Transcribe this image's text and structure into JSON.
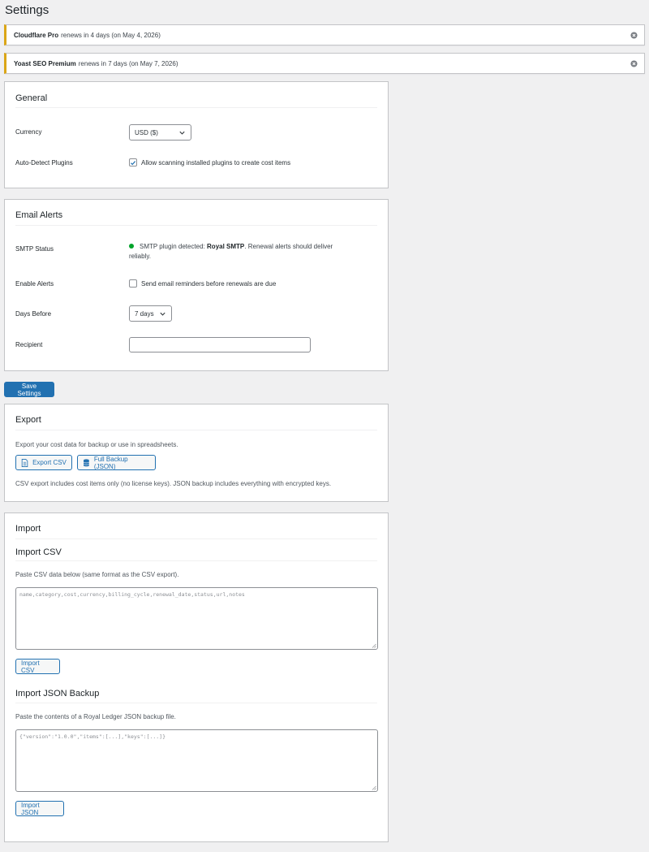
{
  "page": {
    "title": "Settings"
  },
  "notices": [
    {
      "product": "Cloudflare Pro",
      "text": "renews in 4 days (on May 4, 2026)"
    },
    {
      "product": "Yoast SEO Premium",
      "text": "renews in 7 days (on May 7, 2026)"
    }
  ],
  "general": {
    "heading": "General",
    "currency_label": "Currency",
    "currency_value": "USD ($)",
    "autodetect_label": "Auto-Detect Plugins",
    "autodetect_text": "Allow scanning installed plugins to create cost items",
    "autodetect_checked": true
  },
  "email": {
    "heading": "Email Alerts",
    "smtp_label": "SMTP Status",
    "smtp_prefix": "SMTP plugin detected:",
    "smtp_plugin": "Royal SMTP",
    "smtp_suffix": ". Renewal alerts should deliver",
    "smtp_line2": "reliably.",
    "smtp_status_color": "#00a32a",
    "enable_label": "Enable Alerts",
    "enable_text": "Send email reminders before renewals are due",
    "enable_checked": false,
    "days_label": "Days Before",
    "days_value": "7 days",
    "recipient_label": "Recipient",
    "recipient_value": ""
  },
  "save_label": "Save Settings",
  "export": {
    "heading": "Export",
    "desc": "Export your cost data for backup or use in spreadsheets.",
    "csv_label": "Export CSV",
    "json_label": "Full Backup (JSON)",
    "note": "CSV export includes cost items only (no license keys). JSON backup includes everything with encrypted keys."
  },
  "import": {
    "heading": "Import",
    "csv_heading": "Import CSV",
    "csv_desc": "Paste CSV data below (same format as the CSV export).",
    "csv_placeholder": "name,category,cost,currency,billing_cycle,renewal_date,status,url,notes",
    "csv_button": "Import CSV",
    "json_heading": "Import JSON Backup",
    "json_desc": "Paste the contents of a Royal Ledger JSON backup file.",
    "json_placeholder": "{\"version\":\"1.0.0\",\"items\":[...],\"keys\":[...]}",
    "json_button": "Import JSON"
  },
  "colors": {
    "primary": "#2271b1",
    "warning_border": "#dba617",
    "background": "#f0f0f1"
  }
}
